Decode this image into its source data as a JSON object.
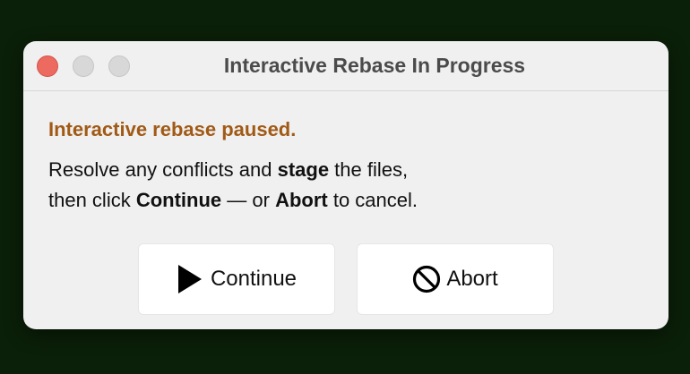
{
  "window": {
    "title": "Interactive Rebase In Progress"
  },
  "dialog": {
    "heading": "Interactive rebase paused.",
    "message": {
      "line1_prefix": "Resolve any conflicts and ",
      "line1_bold": "stage",
      "line1_suffix": " the files,",
      "line2_prefix": "then click ",
      "line2_bold1": "Continue",
      "line2_middle": " — or ",
      "line2_bold2": "Abort",
      "line2_suffix": " to cancel."
    }
  },
  "buttons": {
    "continue_label": "Continue",
    "continue_icon": "play-icon",
    "abort_label": "Abort",
    "abort_icon": "prohibited-icon"
  },
  "colors": {
    "background": "#0b2008",
    "dialog": "#f0f0f0",
    "heading": "#a15a16",
    "close_button": "#ec6a5f"
  }
}
